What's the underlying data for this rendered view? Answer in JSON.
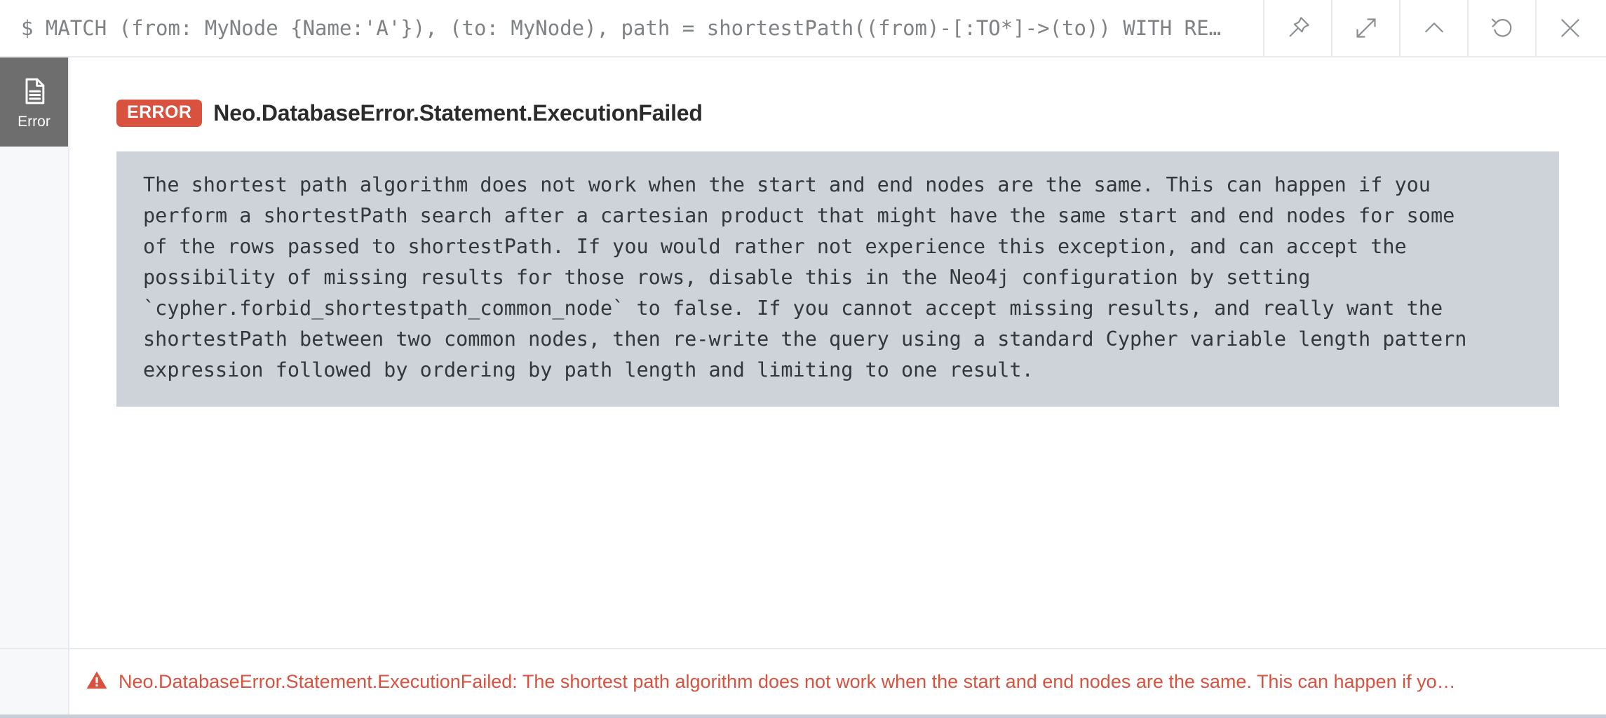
{
  "header": {
    "query": "$ MATCH (from: MyNode {Name:'A'}), (to: MyNode), path = shortestPath((from)-[:TO*]->(to)) WITH RE…",
    "buttons": [
      {
        "name": "pin-button",
        "label": "Pin"
      },
      {
        "name": "expand-button",
        "label": "Expand"
      },
      {
        "name": "collapse-button",
        "label": "Collapse"
      },
      {
        "name": "rerun-button",
        "label": "Rerun"
      },
      {
        "name": "close-button",
        "label": "Close"
      }
    ]
  },
  "sidebar": {
    "items": [
      {
        "label": "Error",
        "icon": "document-icon",
        "active": true
      }
    ]
  },
  "main": {
    "badge": "ERROR",
    "title": "Neo.DatabaseError.Statement.ExecutionFailed",
    "message": "The shortest path algorithm does not work when the start and end nodes are the same. This can happen if you\nperform a shortestPath search after a cartesian product that might have the same start and end nodes for some\nof the rows passed to shortestPath. If you would rather not experience this exception, and can accept the\npossibility of missing results for those rows, disable this in the Neo4j configuration by setting\n`cypher.forbid_shortestpath_common_node` to false. If you cannot accept missing results, and really want the\nshortestPath between two common nodes, then re-write the query using a standard Cypher variable length pattern\nexpression followed by ordering by path length and limiting to one result."
  },
  "statusbar": {
    "icon": "warning-triangle-icon",
    "message": "Neo.DatabaseError.Statement.ExecutionFailed: The shortest path algorithm does not work when the start and end nodes are the same. This can happen if yo…"
  },
  "colors": {
    "error_red": "#d9523f",
    "code_bg": "#ced3d9",
    "sidebar_active": "#6e6e6e",
    "sidebar_bg": "#f6f8f9",
    "border": "#e7eaee"
  }
}
